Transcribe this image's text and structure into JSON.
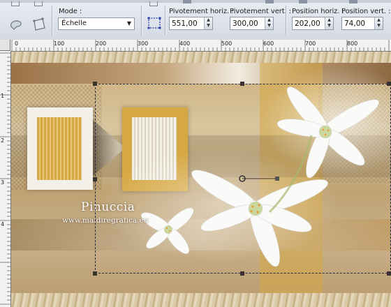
{
  "toolbar": {
    "mode_label": "Mode :",
    "mode_value": "Échelle",
    "fields": [
      {
        "label": "Pivotement horiz. :",
        "value": "551,00"
      },
      {
        "label": "Pivotement vert. :",
        "value": "300,00"
      },
      {
        "label": "Position horiz. :",
        "value": "202,00"
      },
      {
        "label": "Position vert. :",
        "value": "74,00"
      }
    ]
  },
  "ruler": {
    "horizontal": [
      "0",
      "100",
      "200",
      "300",
      "400",
      "500",
      "600",
      "700",
      "800"
    ],
    "vertical": [
      "1",
      "2",
      "3",
      "4"
    ]
  },
  "image": {
    "wordmark": "Pinuccia",
    "url": "www.maidiregrafica.eu"
  },
  "colors": {
    "accent_gold": "#d6a844",
    "canvas_tan": "#c9ab74"
  }
}
